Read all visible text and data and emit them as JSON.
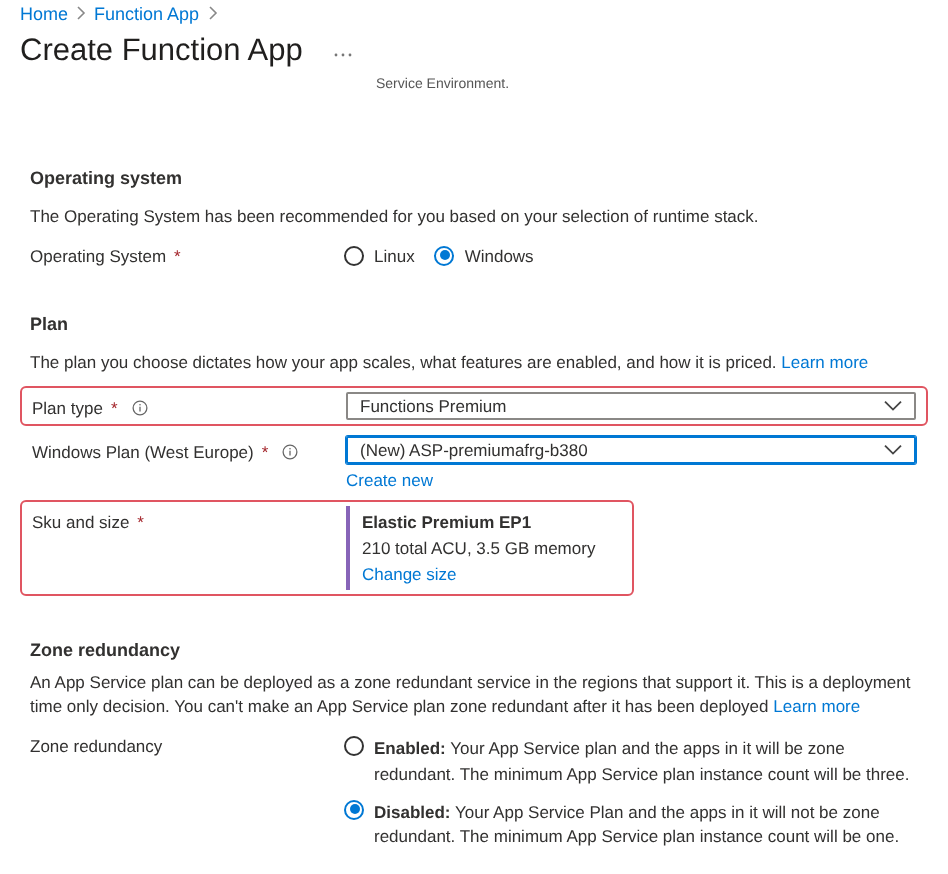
{
  "breadcrumb": [
    {
      "label": "Home"
    },
    {
      "label": "Function App"
    }
  ],
  "title": "Create Function App",
  "truncated_text": "Service Environment.",
  "operating_system": {
    "heading": "Operating system",
    "description": "The Operating System has been recommended for you based on your selection of runtime stack.",
    "label": "Operating System",
    "required_mark": "*",
    "options": [
      {
        "label": "Linux",
        "selected": false
      },
      {
        "label": "Windows",
        "selected": true
      }
    ]
  },
  "plan": {
    "heading": "Plan",
    "description": "The plan you choose dictates how your app scales, what features are enabled, and how it is priced.",
    "link": "Learn more",
    "fields": [
      {
        "kind": "dropdown",
        "label": "Plan type",
        "required_mark": "*",
        "info": true,
        "value": "Functions Premium",
        "focused": false,
        "highlighted": true
      },
      {
        "kind": "dropdown",
        "label": "Windows Plan (West Europe)",
        "required_mark": "*",
        "info": true,
        "value": "(New) ASP-premiumafrg-b380",
        "focused": true,
        "highlighted": false,
        "link": "Create new"
      },
      {
        "kind": "sku",
        "label": "Sku and size",
        "required_mark": "*",
        "name": "Elastic Premium EP1",
        "detail": "210 total ACU, 3.5 GB memory",
        "link": "Change size",
        "highlighted": true
      }
    ]
  },
  "zone_redundancy": {
    "heading": "Zone redundancy",
    "description": "An App Service plan can be deployed as a zone redundant service in the regions that support it. This is a deployment time only decision. You can't make an App Service plan zone redundant after it has been deployed",
    "link": "Learn more",
    "label": "Zone redundancy",
    "options": [
      {
        "label": "Enabled:",
        "text": "Your App Service plan and the apps in it will be zone redundant. The minimum App Service plan instance count will be three.",
        "selected": false
      },
      {
        "label": "Disabled:",
        "text": "Your App Service Plan and the apps in it will not be zone redundant. The minimum App Service plan instance count will be one.",
        "selected": true
      }
    ]
  }
}
